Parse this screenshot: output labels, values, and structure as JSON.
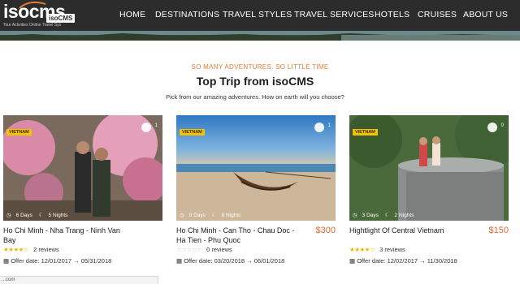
{
  "brand": {
    "logo_text": "isocms",
    "logo_badge": "isoCMS",
    "tagline": "Tour Activities Online Travel Sys"
  },
  "nav": {
    "items": [
      "HOME",
      "DESTINATIONS",
      "TRAVEL STYLES",
      "TRAVEL SERVICES",
      "HOTELS",
      "CRUISES",
      "ABOUT US"
    ]
  },
  "section": {
    "eyebrow": "SO MANY ADVENTURES. SO LITTLE TIME",
    "title": "Top Trip from isoCMS",
    "subtitle": "Pick from our amazing adventures. How on earth will you choose?"
  },
  "trips": [
    {
      "badge": "VIETNAM",
      "likes": "1",
      "days": "6 Days",
      "nights": "5 Nights",
      "title": "Ho Chi Minh - Nha Trang - Ninh Van Bay",
      "price": "",
      "stars": 4,
      "reviews": "2 reviews",
      "offer": "Offer date: 12/01/2017 → 05/31/2018"
    },
    {
      "badge": "VIETNAM",
      "likes": "1",
      "days": "9 Days",
      "nights": "8 Nights",
      "title": "Ho Chi Minh - Can Tho - Chau Doc - Ha Tien - Phu Quoc",
      "price": "$300",
      "stars": 0,
      "reviews": "0 reviews",
      "offer": "Offer date: 03/20/2018 → 06/01/2018"
    },
    {
      "badge": "VIETNAM",
      "likes": "0",
      "days": "3 Days",
      "nights": "2 Nights",
      "title": "Hightlight Of Central Vietnam",
      "price": "$150",
      "stars": 4,
      "reviews": "3 reviews",
      "offer": "Offer date: 12/02/2017 → 11/30/2018"
    }
  ],
  "status_bar": {
    "url": "...com"
  },
  "colors": {
    "header_bg": "#2c2c2c",
    "accent_orange": "#e57b3a",
    "price": "#e06a32",
    "badge": "#f5c200",
    "star": "#f0b400"
  }
}
